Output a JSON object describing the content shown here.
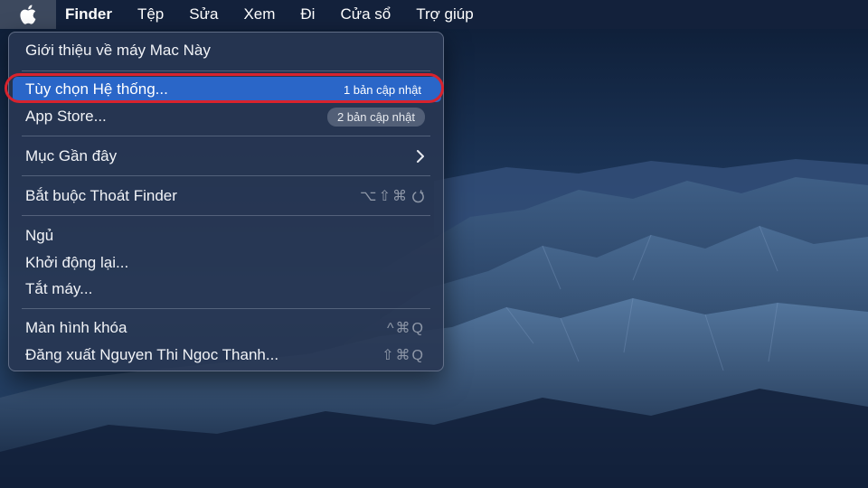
{
  "menubar": {
    "apple_icon": "apple-logo-icon",
    "items": [
      "Finder",
      "Tệp",
      "Sửa",
      "Xem",
      "Đi",
      "Cửa sổ",
      "Trợ giúp"
    ]
  },
  "apple_menu": {
    "about": "Giới thiệu về máy Mac Này",
    "system_prefs": {
      "label": "Tùy chọn Hệ thống...",
      "badge": "1 bản cập nhật"
    },
    "app_store": {
      "label": "App Store...",
      "badge": "2 bản cập nhật"
    },
    "recent_items": {
      "label": "Mục Gần đây",
      "submenu_icon": "chevron-right-icon"
    },
    "force_quit": {
      "label": "Bắt buộc Thoát Finder",
      "shortcut": "⌥⇧⌘",
      "shortcut_icon": "power-icon"
    },
    "sleep": "Ngủ",
    "restart": "Khởi động lại...",
    "shutdown": "Tắt máy...",
    "lock_screen": {
      "label": "Màn hình khóa",
      "shortcut": "^⌘Q"
    },
    "log_out": {
      "label": "Đăng xuất Nguyen Thi Ngoc Thanh...",
      "shortcut": "⇧⌘Q"
    }
  },
  "colors": {
    "highlight": "#2a66c8",
    "annotation_ring": "#d8232d",
    "menubar_bg": "#14223c",
    "sky": "#1d3556"
  }
}
